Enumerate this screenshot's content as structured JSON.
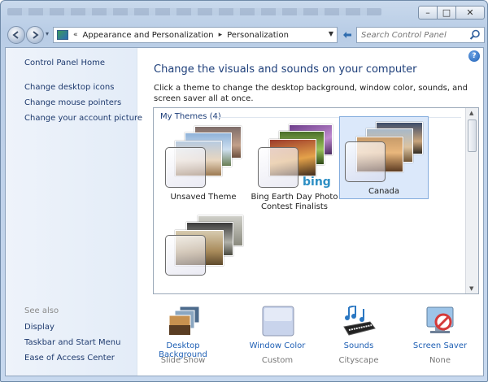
{
  "window": {
    "min_label": "–",
    "max_label": "□",
    "close_label": "✕"
  },
  "address_bar": {
    "history_glyph": "«",
    "crumbs": [
      "Appearance and Personalization",
      "Personalization"
    ],
    "separator": "▸",
    "dropdown_glyph": "▼"
  },
  "search": {
    "placeholder": "Search Control Panel"
  },
  "sidebar": {
    "home": "Control Panel Home",
    "links": [
      "Change desktop icons",
      "Change mouse pointers",
      "Change your account picture"
    ],
    "see_also_label": "See also",
    "see_also": [
      "Display",
      "Taskbar and Start Menu",
      "Ease of Access Center"
    ]
  },
  "main": {
    "help_glyph": "?",
    "title": "Change the visuals and sounds on your computer",
    "description": "Click a theme to change the desktop background, window color, sounds, and screen saver all at once.",
    "group_label": "My Themes (4)",
    "themes": [
      {
        "label": "Unsaved Theme",
        "selected": false
      },
      {
        "label": "Bing Earth Day Photo Contest Finalists",
        "selected": false,
        "badge": "bing"
      },
      {
        "label": "Canada",
        "selected": true
      },
      {
        "label": "",
        "selected": false
      }
    ]
  },
  "bottom": [
    {
      "label": "Desktop Background",
      "value": "Slide Show",
      "icon": "desktop-background-icon"
    },
    {
      "label": "Window Color",
      "value": "Custom",
      "icon": "window-color-icon"
    },
    {
      "label": "Sounds",
      "value": "Cityscape",
      "icon": "sounds-icon"
    },
    {
      "label": "Screen Saver",
      "value": "None",
      "icon": "screen-saver-icon"
    }
  ],
  "colors": {
    "link": "#1e3a6e",
    "accent": "#1e5fb4",
    "selection": "#dbe8fa"
  }
}
